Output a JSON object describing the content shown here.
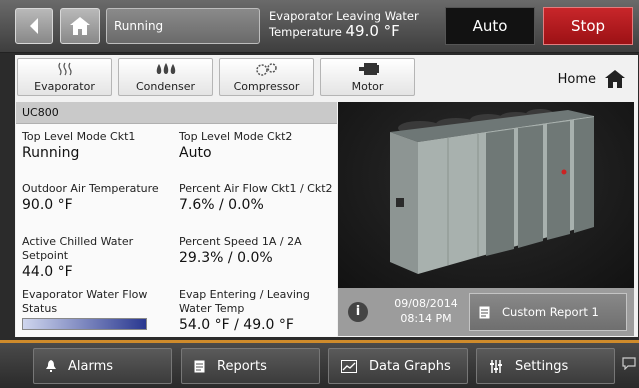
{
  "topbar": {
    "status": "Running",
    "evap_label": "Evaporator Leaving Water",
    "evap_temp_label": "Temperature",
    "evap_temp_value": "49.0 °F",
    "auto_label": "Auto",
    "stop_label": "Stop",
    "stop_color": "#b51a1e"
  },
  "nav": {
    "tabs": [
      {
        "label": "Evaporator",
        "icon": "heat-waves-icon"
      },
      {
        "label": "Condenser",
        "icon": "droplets-icon"
      },
      {
        "label": "Compressor",
        "icon": "gears-icon"
      },
      {
        "label": "Motor",
        "icon": "motor-icon"
      }
    ],
    "home_label": "Home"
  },
  "panel": {
    "header": "UC800",
    "cells": {
      "mode1_label": "Top Level Mode Ckt1",
      "mode1_value": "Running",
      "mode2_label": "Top Level Mode Ckt2",
      "mode2_value": "Auto",
      "oat_label": "Outdoor Air Temperature",
      "oat_value": "90.0 °F",
      "airflow_label": "Percent Air Flow Ckt1 / Ckt2",
      "airflow_value": "7.6% / 0.0%",
      "setpoint_label_1": "Active Chilled Water",
      "setpoint_label_2": "Setpoint",
      "setpoint_value": "44.0 °F",
      "speed_label": "Percent Speed 1A / 2A",
      "speed_value": "29.3% / 0.0%",
      "flow_label_1": "Evaporator Water Flow",
      "flow_label_2": "Status",
      "evaptemp_label_1": "Evap Entering / Leaving",
      "evaptemp_label_2": "Water Temp",
      "evaptemp_value": "54.0 °F / 49.0 °F"
    }
  },
  "info": {
    "date": "09/08/2014",
    "time": "08:14 PM",
    "custom_report_label": "Custom Report 1"
  },
  "bottom": {
    "alarms": "Alarms",
    "reports": "Reports",
    "graphs": "Data Graphs",
    "settings": "Settings"
  }
}
